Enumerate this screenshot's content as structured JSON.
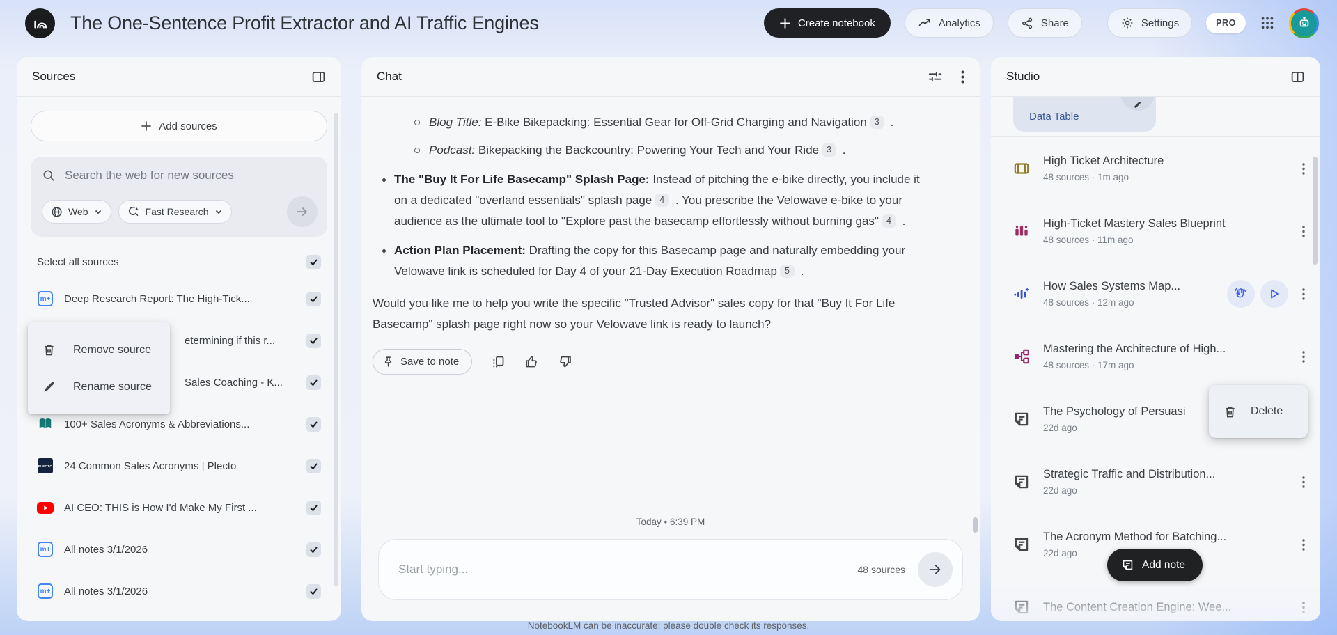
{
  "header": {
    "title": "The One-Sentence Profit Extractor and AI Traffic Engines",
    "create_notebook": "Create notebook",
    "analytics": "Analytics",
    "share": "Share",
    "settings": "Settings",
    "pro_badge": "PRO"
  },
  "sources": {
    "panel_title": "Sources",
    "add_button": "Add sources",
    "search_placeholder": "Search the web for new sources",
    "web_filter": "Web",
    "mode_filter": "Fast Research",
    "select_all": "Select all sources",
    "items": [
      {
        "title": "Deep Research Report: The High-Tick..."
      },
      {
        "title": "etermining if this r..."
      },
      {
        "title": "Sales Coaching - K..."
      },
      {
        "title": "100+ Sales Acronyms & Abbreviations..."
      },
      {
        "title": "24 Common Sales Acronyms | Plecto"
      },
      {
        "title": "AI CEO: THIS is How I'd Make My First ..."
      },
      {
        "title": "All notes 3/1/2026"
      },
      {
        "title": "All notes 3/1/2026"
      }
    ],
    "context_menu": {
      "remove": "Remove source",
      "rename": "Rename source"
    },
    "plecto_logo": "PLECTO",
    "note_icon_text": "m+"
  },
  "chat": {
    "panel_title": "Chat",
    "sub_bullets": [
      {
        "lead": "Blog Title:",
        "text": " E-Bike Bikepacking: Essential Gear for Off-Grid Charging and Navigation",
        "cite": "3",
        "tail": " ."
      },
      {
        "lead": "Podcast:",
        "text": " Bikepacking the Backcountry: Powering Your Tech and Your Ride",
        "cite": "3",
        "tail": " ."
      }
    ],
    "bullets": [
      {
        "lead": "The \"Buy It For Life Basecamp\" Splash Page:",
        "seg1": " Instead of pitching the e-bike directly, you include it on a dedicated \"overland essentials\" splash page",
        "cite1": "4",
        "seg2": " . You prescribe the Velowave e-bike to your audience as the ultimate tool to \"Explore past the basecamp effortlessly without burning gas\"",
        "cite2": "4",
        "tail": " ."
      },
      {
        "lead": "Action Plan Placement:",
        "seg1": " Drafting the copy for this Basecamp page and naturally embedding your Velowave link is scheduled for Day 4 of your 21-Day Execution Roadmap",
        "cite1": "5",
        "tail": " ."
      }
    ],
    "closing": "Would you like me to help you write the specific \"Trusted Advisor\" sales copy for that \"Buy It For Life Basecamp\" splash page right now so your Velowave link is ready to launch?",
    "save_to_note": "Save to note",
    "date_divider": "Today • 6:39 PM",
    "input_placeholder": "Start typing...",
    "source_count": "48 sources"
  },
  "studio": {
    "panel_title": "Studio",
    "scrolled_chip": "Data Table",
    "items": [
      {
        "title": "High Ticket Architecture",
        "meta": "48 sources · 1m ago"
      },
      {
        "title": "High-Ticket Mastery Sales Blueprint",
        "meta": "48 sources · 11m ago"
      },
      {
        "title": "How Sales Systems Map...",
        "meta": "48 sources · 12m ago"
      },
      {
        "title": "Mastering the Architecture of High...",
        "meta": "48 sources · 17m ago"
      },
      {
        "title": "The Psychology of Persuasi",
        "meta": "22d ago"
      },
      {
        "title": "Strategic Traffic and Distribution...",
        "meta": "22d ago"
      },
      {
        "title": "The Acronym Method for Batching...",
        "meta": "22d ago"
      },
      {
        "title": "The Content Creation Engine: Wee...",
        "meta": ""
      }
    ],
    "context_menu": {
      "delete": "Delete"
    },
    "add_note": "Add note"
  },
  "footer": {
    "disclaimer": "NotebookLM can be inaccurate; please double check its responses."
  },
  "colors": {
    "accent_blue": "#4285f4",
    "dark_button": "#202124",
    "chip_blue_text": "#3b5893"
  }
}
